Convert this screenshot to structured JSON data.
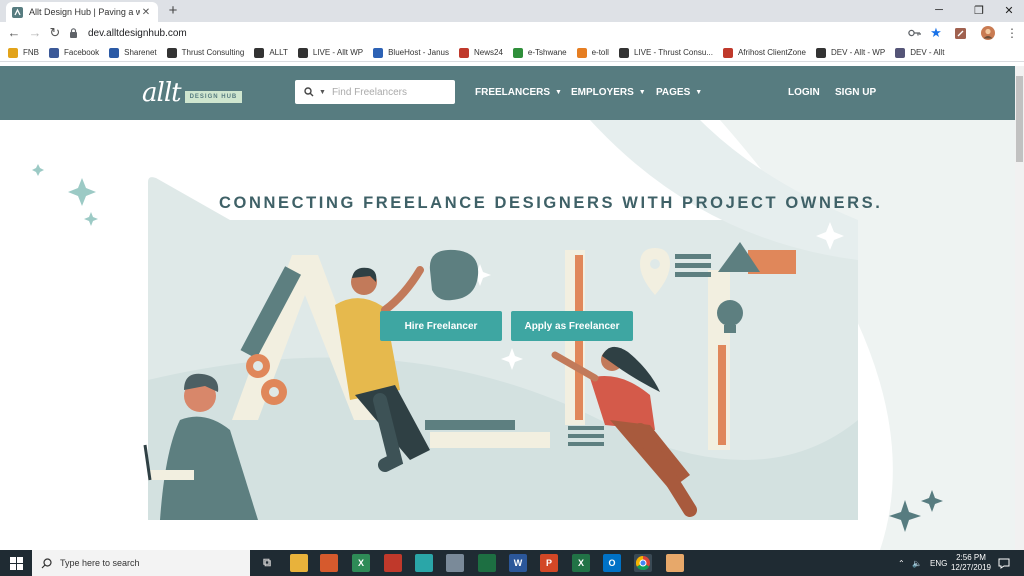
{
  "browser": {
    "tab_title": "Allt Design Hub | Paving a way t",
    "url": "dev.alltdesignhub.com",
    "bookmarks": [
      {
        "label": "FNB",
        "color": "#e2a31a"
      },
      {
        "label": "Facebook",
        "color": "#3b5998"
      },
      {
        "label": "Sharenet",
        "color": "#2b5aa6"
      },
      {
        "label": "Thrust Consulting",
        "color": "#333333"
      },
      {
        "label": "ALLT",
        "color": "#333333"
      },
      {
        "label": "LIVE - Allt WP",
        "color": "#333333"
      },
      {
        "label": "BlueHost - Janus",
        "color": "#2d62b5"
      },
      {
        "label": "News24",
        "color": "#c0392b"
      },
      {
        "label": "e-Tshwane",
        "color": "#2f8f3a"
      },
      {
        "label": "e-toll",
        "color": "#e67e22"
      },
      {
        "label": "LIVE - Thrust Consu...",
        "color": "#333333"
      },
      {
        "label": "Afrihost ClientZone",
        "color": "#c0392b"
      },
      {
        "label": "DEV - Allt - WP",
        "color": "#333333"
      },
      {
        "label": "DEV - Allt",
        "color": "#555577"
      }
    ]
  },
  "site": {
    "logo_text": "allt",
    "logo_badge": "DESIGN HUB",
    "search_placeholder": "Find Freelancers",
    "nav": {
      "freelancers": "FREELANCERS",
      "employers": "EMPLOYERS",
      "pages": "PAGES",
      "login": "LOGIN",
      "signup": "SIGN UP"
    },
    "hero": {
      "headline": "CONNECTING FREELANCE DESIGNERS WITH PROJECT OWNERS.",
      "hire_button": "Hire Freelancer",
      "apply_button": "Apply as Freelancer"
    }
  },
  "taskbar": {
    "search_placeholder": "Type here to search",
    "language": "ENG",
    "time": "2:56 PM",
    "date": "12/27/2019"
  },
  "colors": {
    "header": "#577c80",
    "accent": "#3ea6a2",
    "headline": "#3f6167",
    "orange": "#e0875a"
  }
}
